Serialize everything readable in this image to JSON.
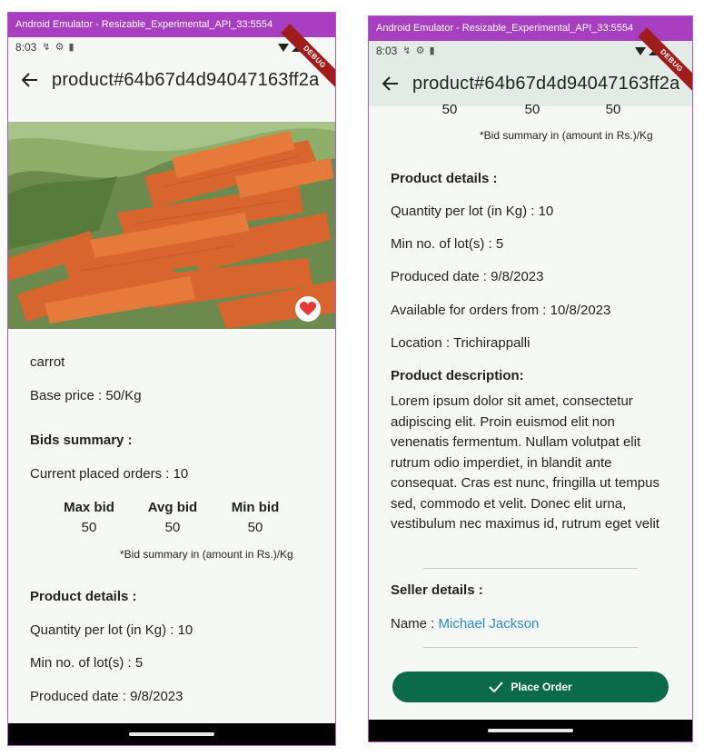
{
  "window": {
    "title": "Android Emulator - Resizable_Experimental_API_33:5554"
  },
  "status": {
    "time": "8:03",
    "debug_label": "DEBUG"
  },
  "appbar": {
    "title": "product#64b67d4d94047163ff2a"
  },
  "product": {
    "name": "carrot",
    "base_price": "Base price : 50/Kg",
    "bids_heading": "Bids summary :",
    "current_orders": "Current placed orders : 10",
    "bids": [
      {
        "label": "Max bid",
        "value": "50"
      },
      {
        "label": "Avg bid",
        "value": "50"
      },
      {
        "label": "Min bid",
        "value": "50"
      }
    ],
    "bid_note": "*Bid summary in (amount in Rs.)/Kg",
    "details_heading": "Product details :",
    "quantity": "Quantity per lot (in Kg) : 10",
    "min_lots": "Min no. of lot(s) : 5",
    "produced": "Produced date : 9/8/2023",
    "available": "Available for orders from : 10/8/2023",
    "location": "Location : Trichirappalli",
    "description_heading": "Product description:",
    "description": "Lorem ipsum dolor sit amet, consectetur adipiscing elit. Proin euismod elit non venenatis fermentum. Nullam volutpat elit rutrum odio imperdiet, in blandit ante consequat. Cras est nunc, fringilla ut tempus sed, commodo et velit. Donec elit urna, vestibulum nec maximus id, rutrum eget velit"
  },
  "seller": {
    "heading": "Seller details :",
    "name_label": "Name : ",
    "name": "Michael Jackson"
  },
  "actions": {
    "place_order": "Place Order"
  },
  "colors": {
    "titlebar": "#a83fc0",
    "button": "#0a6a4a",
    "link": "#2a8ad8",
    "heart": "#e53935"
  }
}
